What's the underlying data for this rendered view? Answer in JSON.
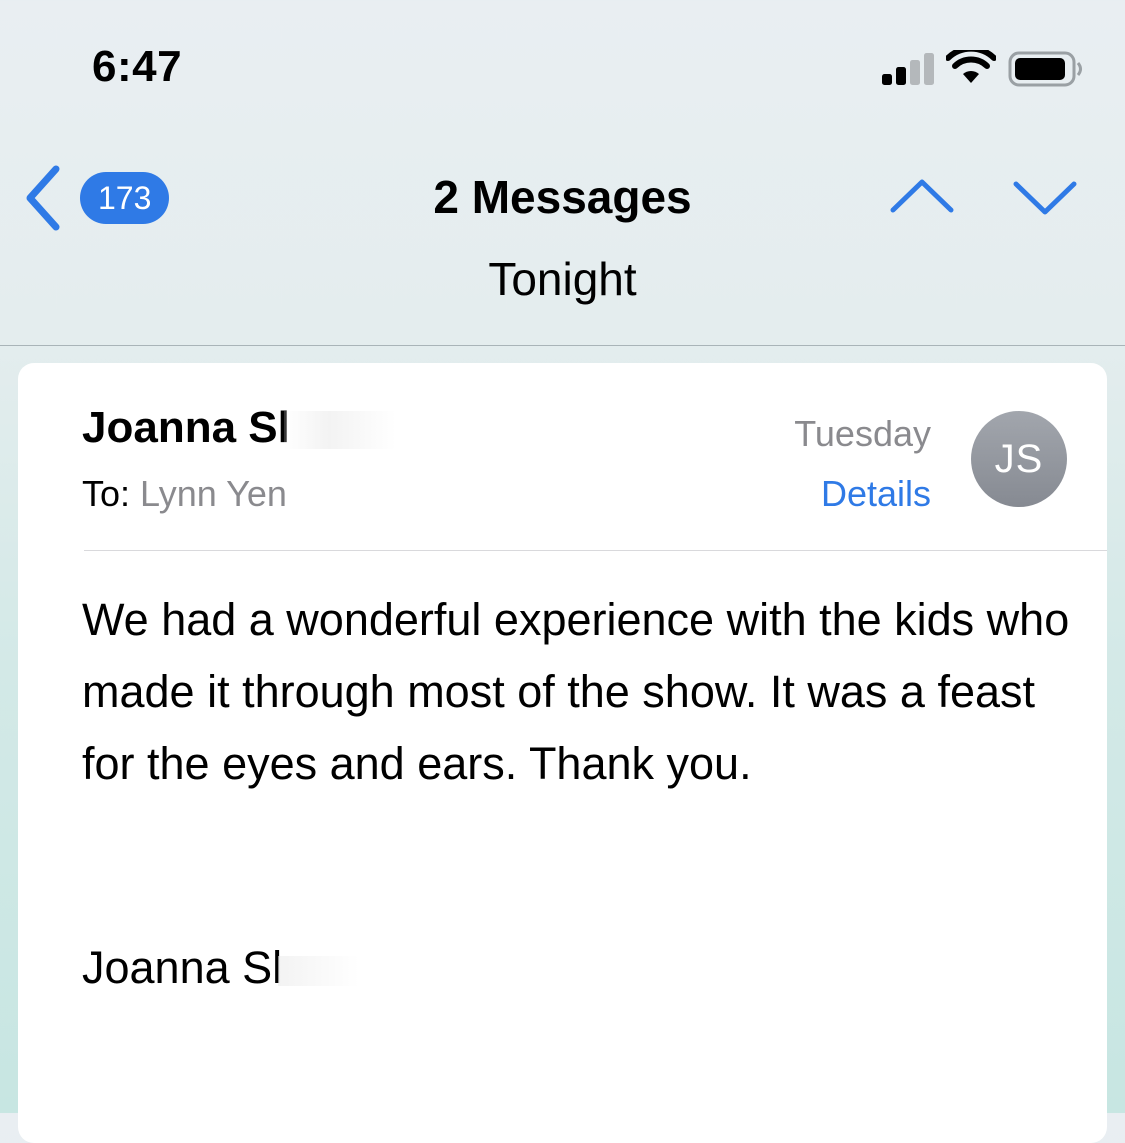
{
  "status_bar": {
    "time": "6:47",
    "icons": [
      "cellular-signal-icon",
      "wifi-icon",
      "battery-icon"
    ]
  },
  "nav": {
    "unread_count": "173",
    "title": "2 Messages",
    "subtitle": "Tonight",
    "icons": [
      "back-chevron-icon",
      "chevron-up-icon",
      "chevron-down-icon"
    ]
  },
  "message": {
    "sender_visible": "Joanna Sl",
    "to_label": "To:",
    "recipient": "Lynn Yen",
    "date": "Tuesday",
    "details_label": "Details",
    "avatar_initials": "JS",
    "body": [
      "We had a wonderful experience with the kids who made it through most of the show. It was a feast for the eyes and ears. Thank you."
    ],
    "signature_visible": "Joanna Sl"
  },
  "colors": {
    "accent": "#2f7ae6",
    "secondary_text": "#8a8a8e",
    "avatar": "#8e9299"
  }
}
